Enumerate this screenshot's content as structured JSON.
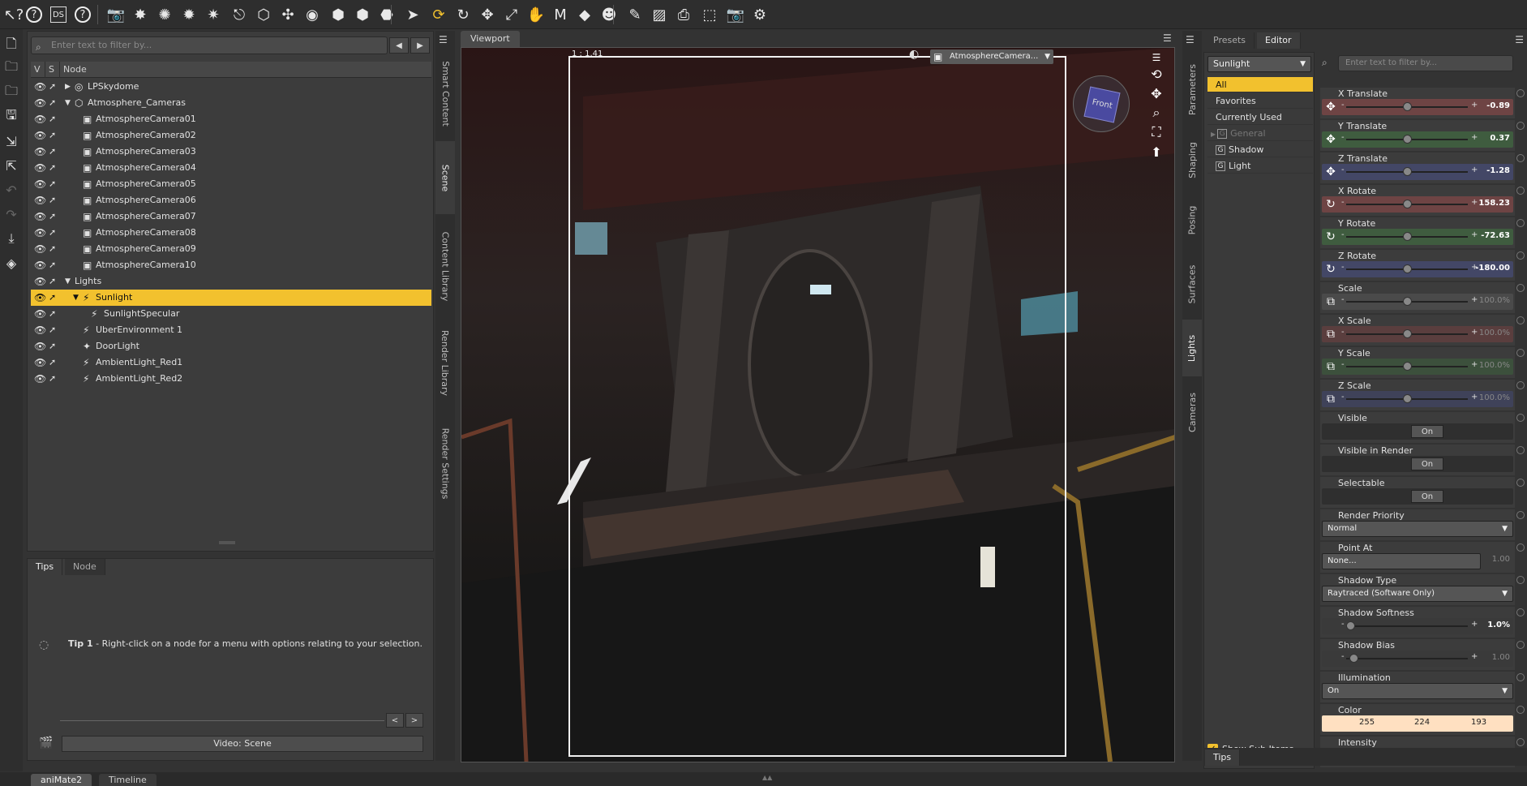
{
  "toolbar": {
    "icons": [
      "help-pointer-icon",
      "help-icon",
      "ds-logo-icon",
      "help-circle-icon",
      "camera-add-icon",
      "spotlight-add-icon",
      "point-light-add-icon",
      "distant-light-add-icon",
      "spot-light-add-icon",
      "camera-tool-icon",
      "primitive-cube-icon",
      "select-node-icon",
      "universal-node-icon",
      "rigid-follow-icon",
      "geometry-editor-icon",
      "joint-editor-icon",
      "pointer-tool-icon",
      "rotate-tool-active-icon",
      "rotate-icon",
      "translate-icon",
      "scale-icon",
      "pose-tool-icon",
      "morph-tool-icon",
      "surface-tool-icon",
      "figure-tool-icon",
      "spot-render-icon",
      "window-tool-icon",
      "render-camera-icon",
      "region-select-icon",
      "render-icon",
      "render-settings-icon"
    ]
  },
  "scene": {
    "filter_placeholder": "Enter text to filter by...",
    "columns": {
      "v": "V",
      "s": "S",
      "node": "Node"
    },
    "nodes": [
      {
        "label": "LPSkydome",
        "indent": 0,
        "arrow": "▶",
        "icon": "◎",
        "selected": false
      },
      {
        "label": "Atmosphere_Cameras",
        "indent": 0,
        "arrow": "▼",
        "icon": "⬡",
        "selected": false
      },
      {
        "label": "AtmosphereCamera01",
        "indent": 1,
        "arrow": "",
        "icon": "▣",
        "selected": false
      },
      {
        "label": "AtmosphereCamera02",
        "indent": 1,
        "arrow": "",
        "icon": "▣",
        "selected": false
      },
      {
        "label": "AtmosphereCamera03",
        "indent": 1,
        "arrow": "",
        "icon": "▣",
        "selected": false
      },
      {
        "label": "AtmosphereCamera04",
        "indent": 1,
        "arrow": "",
        "icon": "▣",
        "selected": false
      },
      {
        "label": "AtmosphereCamera05",
        "indent": 1,
        "arrow": "",
        "icon": "▣",
        "selected": false
      },
      {
        "label": "AtmosphereCamera06",
        "indent": 1,
        "arrow": "",
        "icon": "▣",
        "selected": false
      },
      {
        "label": "AtmosphereCamera07",
        "indent": 1,
        "arrow": "",
        "icon": "▣",
        "selected": false
      },
      {
        "label": "AtmosphereCamera08",
        "indent": 1,
        "arrow": "",
        "icon": "▣",
        "selected": false
      },
      {
        "label": "AtmosphereCamera09",
        "indent": 1,
        "arrow": "",
        "icon": "▣",
        "selected": false
      },
      {
        "label": "AtmosphereCamera10",
        "indent": 1,
        "arrow": "",
        "icon": "▣",
        "selected": false
      },
      {
        "label": "Lights",
        "indent": 0,
        "arrow": "▼",
        "icon": "",
        "selected": false
      },
      {
        "label": "Sunlight",
        "indent": 1,
        "arrow": "▼",
        "icon": "⚡",
        "selected": true
      },
      {
        "label": "SunlightSpecular",
        "indent": 2,
        "arrow": "",
        "icon": "⚡",
        "selected": false
      },
      {
        "label": "UberEnvironment 1",
        "indent": 1,
        "arrow": "",
        "icon": "⚡",
        "selected": false
      },
      {
        "label": "DoorLight",
        "indent": 1,
        "arrow": "",
        "icon": "✦",
        "selected": false
      },
      {
        "label": "AmbientLight_Red1",
        "indent": 1,
        "arrow": "",
        "icon": "⚡",
        "selected": false
      },
      {
        "label": "AmbientLight_Red2",
        "indent": 1,
        "arrow": "",
        "icon": "⚡",
        "selected": false
      }
    ]
  },
  "left_tabs": [
    "Smart Content",
    "Scene",
    "Content Library",
    "Render Library",
    "Render Settings"
  ],
  "tips": {
    "tabs": [
      "Tips",
      "Node"
    ],
    "tip_title": "Tip 1",
    "tip_text": " - Right-click on a node for a menu with options relating to your selection.",
    "prev": "<",
    "next": ">",
    "video_button": "Video: Scene"
  },
  "viewport": {
    "tab": "Viewport",
    "ratio": "1 : 1.41",
    "camera": "AtmosphereCamera...",
    "cube_label": "Front"
  },
  "right_tabs": [
    "Parameters",
    "Shaping",
    "Posing",
    "Surfaces",
    "Lights",
    "Cameras"
  ],
  "editor": {
    "tabs": [
      "Presets",
      "Editor"
    ],
    "node_select": "Sunlight",
    "filter_placeholder": "Enter text to filter by...",
    "groups": [
      {
        "label": "All",
        "active": true,
        "badge": "",
        "dim": false
      },
      {
        "label": "Favorites",
        "active": false,
        "badge": "",
        "dim": false
      },
      {
        "label": "Currently Used",
        "active": false,
        "badge": "",
        "dim": false
      },
      {
        "label": "General",
        "active": false,
        "badge": "G",
        "dim": true
      },
      {
        "label": "Shadow",
        "active": false,
        "badge": "G",
        "dim": false
      },
      {
        "label": "Light",
        "active": false,
        "badge": "G",
        "dim": false
      }
    ],
    "show_sub_items": "Show Sub Items",
    "bottom_tab": "Tips",
    "props": [
      {
        "label": "X Translate",
        "kind": "slider",
        "value": "-0.89",
        "color": "#6e4444",
        "icon": "✥",
        "knob": 0.5,
        "dim": false
      },
      {
        "label": "Y Translate",
        "kind": "slider",
        "value": "0.37",
        "color": "#3f5c3f",
        "icon": "✥",
        "knob": 0.5,
        "dim": false
      },
      {
        "label": "Z Translate",
        "kind": "slider",
        "value": "-1.28",
        "color": "#434766",
        "icon": "✥",
        "knob": 0.5,
        "dim": false
      },
      {
        "label": "X Rotate",
        "kind": "slider",
        "value": "158.23",
        "color": "#6e4444",
        "icon": "↻",
        "knob": 0.5,
        "dim": false
      },
      {
        "label": "Y Rotate",
        "kind": "slider",
        "value": "-72.63",
        "color": "#3f5c3f",
        "icon": "↻",
        "knob": 0.5,
        "dim": false
      },
      {
        "label": "Z Rotate",
        "kind": "slider",
        "value": "-180.00",
        "color": "#434766",
        "icon": "↻",
        "knob": 0.5,
        "dim": false
      },
      {
        "label": "Scale",
        "kind": "slider",
        "value": "100.0%",
        "color": "#4a4a4a",
        "icon": "⧉",
        "knob": 0.5,
        "dim": true
      },
      {
        "label": "X Scale",
        "kind": "slider",
        "value": "100.0%",
        "color": "#5a3e3e",
        "icon": "⧉",
        "knob": 0.5,
        "dim": true
      },
      {
        "label": "Y Scale",
        "kind": "slider",
        "value": "100.0%",
        "color": "#3c503c",
        "icon": "⧉",
        "knob": 0.5,
        "dim": true
      },
      {
        "label": "Z Scale",
        "kind": "slider",
        "value": "100.0%",
        "color": "#3f4259",
        "icon": "⧉",
        "knob": 0.5,
        "dim": true
      },
      {
        "label": "Visible",
        "kind": "onoff",
        "value": "On"
      },
      {
        "label": "Visible in Render",
        "kind": "onoff",
        "value": "On"
      },
      {
        "label": "Selectable",
        "kind": "onoff",
        "value": "On"
      },
      {
        "label": "Render Priority",
        "kind": "combo",
        "value": "Normal"
      },
      {
        "label": "Point At",
        "kind": "pointat",
        "value": "None...",
        "extra": "1.00"
      },
      {
        "label": "Shadow Type",
        "kind": "combo",
        "value": "Raytraced (Software Only)"
      },
      {
        "label": "Shadow Softness",
        "kind": "slider",
        "value": "1.0%",
        "color": "#3a3a3a",
        "icon": "",
        "knob": 0.03,
        "dim": false
      },
      {
        "label": "Shadow Bias",
        "kind": "slider",
        "value": "1.00",
        "color": "#3a3a3a",
        "icon": "",
        "knob": 0.06,
        "dim": true
      },
      {
        "label": "Illumination",
        "kind": "combo",
        "value": "On"
      },
      {
        "label": "Color",
        "kind": "color",
        "r": "255",
        "g": "224",
        "b": "193"
      },
      {
        "label": "Intensity",
        "kind": "label"
      }
    ]
  },
  "bottom": {
    "tabs": [
      "aniMate2",
      "Timeline"
    ]
  }
}
